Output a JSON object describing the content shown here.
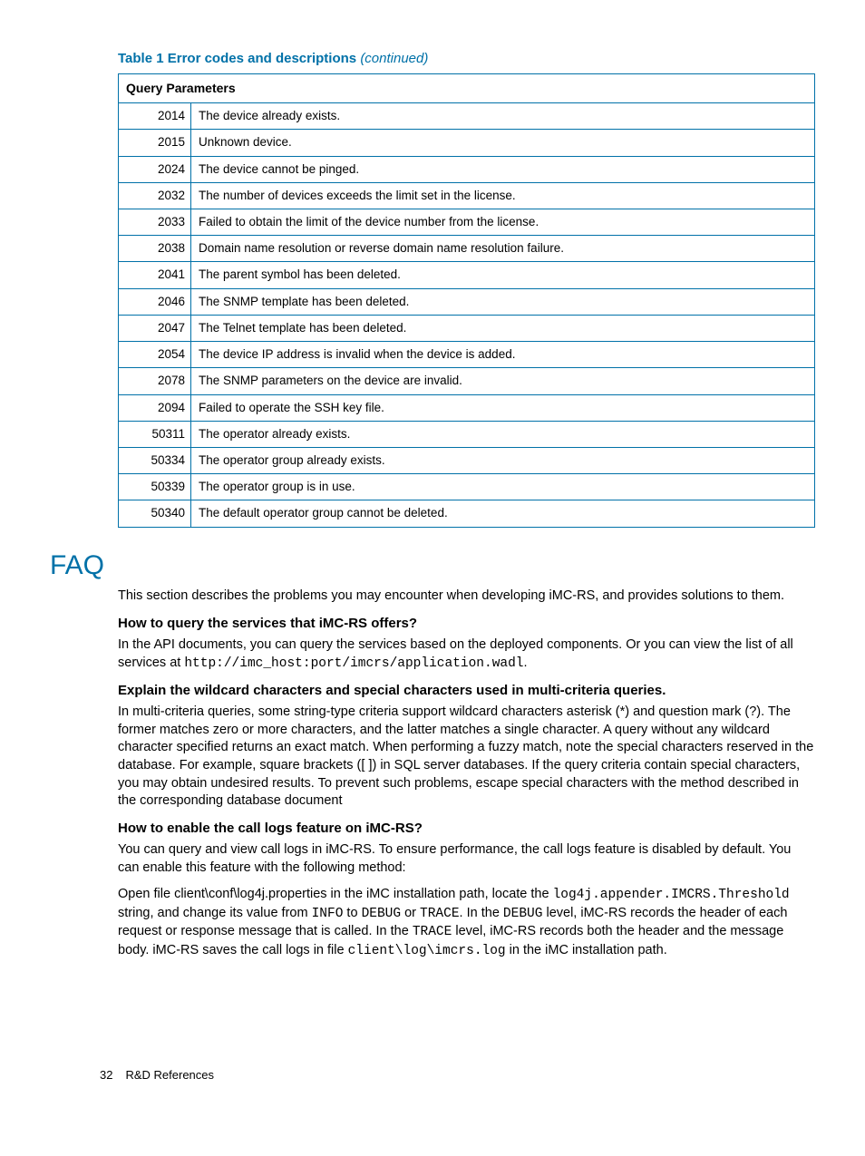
{
  "table": {
    "caption_prefix": "Table 1 Error codes and descriptions ",
    "caption_suffix": "(continued)",
    "header": "Query Parameters",
    "rows": [
      {
        "code": "2014",
        "desc": "The device already exists."
      },
      {
        "code": "2015",
        "desc": "Unknown device."
      },
      {
        "code": "2024",
        "desc": "The device cannot be pinged."
      },
      {
        "code": "2032",
        "desc": "The number of devices exceeds the limit set in the license."
      },
      {
        "code": "2033",
        "desc": "Failed to obtain the limit of the device number from the license."
      },
      {
        "code": "2038",
        "desc": "Domain name resolution or reverse domain name resolution failure."
      },
      {
        "code": "2041",
        "desc": "The parent symbol has been deleted."
      },
      {
        "code": "2046",
        "desc": "The SNMP template has been deleted."
      },
      {
        "code": "2047",
        "desc": "The Telnet template has been deleted."
      },
      {
        "code": "2054",
        "desc": "The device IP address is invalid when the device is added."
      },
      {
        "code": "2078",
        "desc": "The SNMP parameters on the device are invalid."
      },
      {
        "code": "2094",
        "desc": "Failed to operate the SSH key file."
      },
      {
        "code": "50311",
        "desc": "The operator already exists."
      },
      {
        "code": "50334",
        "desc": "The operator group already exists."
      },
      {
        "code": "50339",
        "desc": "The operator group is in use."
      },
      {
        "code": "50340",
        "desc": "The default operator group cannot be deleted."
      }
    ]
  },
  "faq": {
    "title": "FAQ",
    "intro": "This section describes the problems you may encounter when developing iMC-RS, and provides solutions to them.",
    "q1": "How to query the services that iMC-RS offers?",
    "a1_pre": "In the API documents, you can query the services based on the deployed components. Or you can view the list of all services at ",
    "a1_code": "http://imc_host:port/imcrs/application.wadl",
    "a1_post": ".",
    "q2": "Explain the wildcard characters and special characters used in multi-criteria queries.",
    "a2": "In multi-criteria queries, some string-type criteria support wildcard characters asterisk (*) and question mark (?). The former matches zero or more characters, and the latter matches a single character. A query without any wildcard character specified returns an exact match. When performing a fuzzy match, note the special characters reserved in the database. For example, square brackets ([ ]) in SQL server databases. If the query criteria contain special characters, you may obtain undesired results. To prevent such problems, escape special characters with the method described in the corresponding database document",
    "q3": "How to enable the call logs feature on iMC-RS?",
    "a3a": "You can query and view call logs in iMC-RS. To ensure performance, the call logs feature is disabled by default. You can enable this feature with the following method:",
    "a3b_1": "Open file client\\conf\\log4j.properties in the iMC installation path, locate the ",
    "a3b_code1": "log4j.appender.IMCRS.Threshold",
    "a3b_2": " string, and change its value from ",
    "a3b_code2": "INFO",
    "a3b_3": " to ",
    "a3b_code3": "DEBUG",
    "a3b_4": " or ",
    "a3b_code4": "TRACE",
    "a3b_5": ". In the ",
    "a3b_code5": "DEBUG",
    "a3b_6": " level, iMC-RS records the header of each request or response message that is called. In the ",
    "a3b_code6": "TRACE",
    "a3b_7": " level, iMC-RS records both the header and the message body. iMC-RS saves the call logs in file ",
    "a3b_code7": "client\\log\\imcrs.log",
    "a3b_8": " in the iMC installation path."
  },
  "footer": {
    "page": "32",
    "section": "R&D References"
  }
}
